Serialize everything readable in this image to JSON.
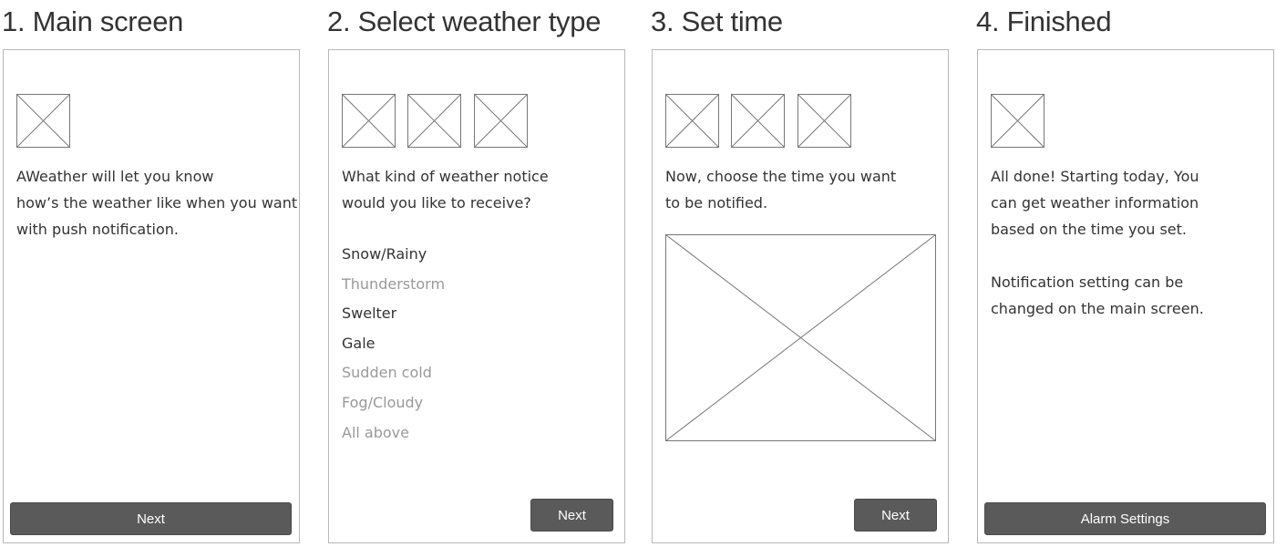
{
  "steps": [
    {
      "title": "1. Main screen",
      "text_lines": [
        "AWeather will let you know",
        "how’s the weather like when you want",
        "with push notification."
      ],
      "button_label": "Next"
    },
    {
      "title": "2. Select weather type",
      "text_lines": [
        "What kind of weather notice",
        "would you like to receive?"
      ],
      "options": [
        {
          "label": "Snow/Rainy",
          "selected": true
        },
        {
          "label": "Thunderstorm",
          "selected": false
        },
        {
          "label": "Swelter",
          "selected": true
        },
        {
          "label": "Gale",
          "selected": true
        },
        {
          "label": "Sudden cold",
          "selected": false
        },
        {
          "label": "Fog/Cloudy",
          "selected": false
        },
        {
          "label": "All above",
          "selected": false
        }
      ],
      "button_label": "Next"
    },
    {
      "title": "3. Set time",
      "text_lines": [
        "Now, choose the time you want",
        "to be notified."
      ],
      "button_label": "Next"
    },
    {
      "title": "4. Finished",
      "text_lines": [
        "All done! Starting today, You",
        "can get weather information",
        "based on the time you set.",
        "",
        "Notification setting can be",
        "changed on the main screen."
      ],
      "button_label": "Alarm Settings"
    }
  ],
  "colors": {
    "text": "#333333",
    "text_unselected": "#9a9a9a",
    "button_fill": "#5a5a5a",
    "button_text": "#ffffff",
    "panel_border": "#b8b8b8",
    "placeholder_stroke": "#777777"
  },
  "icons": {
    "image_placeholder": "image-placeholder-icon"
  }
}
